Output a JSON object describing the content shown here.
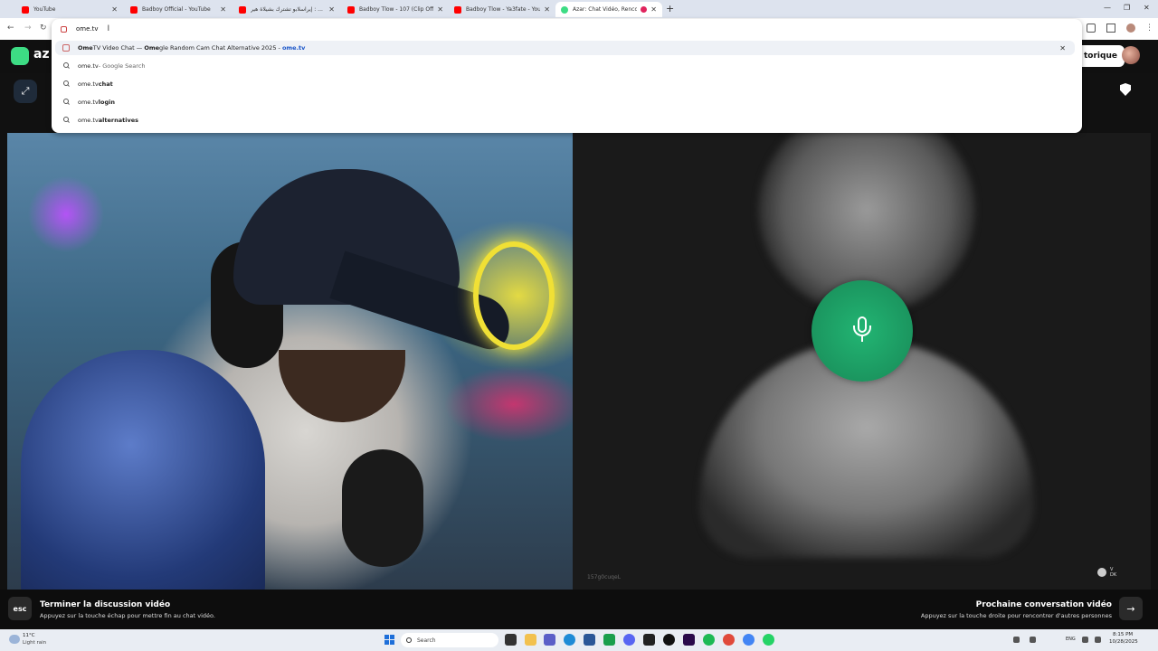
{
  "browser": {
    "tabs": [
      {
        "title": "YouTube",
        "favicon": "youtube-icon",
        "active": false
      },
      {
        "title": "Badboy Official - YouTube",
        "favicon": "youtube-icon",
        "active": false
      },
      {
        "title": "إيراسلابو تشترك بشيلاة هير : ...",
        "favicon": "youtube-icon",
        "active": false
      },
      {
        "title": "Badboy Tlow - 107 (Clip Officiel)",
        "favicon": "youtube-icon",
        "active": false
      },
      {
        "title": "Badboy Tlow - Ya3fate - YouTube",
        "favicon": "youtube-icon",
        "active": false
      },
      {
        "title": "Azar: Chat Vidéo, Rencontre",
        "favicon": "azar-icon",
        "active": true
      }
    ],
    "omnibox": {
      "input_value": "ome.tv",
      "suggestions": [
        {
          "prefix": "Ome",
          "rest": "TV Video Chat — ",
          "match2": "Ome",
          "rest2": "gle Random Cam Chat Alternative 2025 - ",
          "url": "ome.tv",
          "icon": "history-icon"
        },
        {
          "query": "ome.tv",
          "extra": "",
          "suffix": " - Google Search",
          "icon": "search-icon"
        },
        {
          "query": "ome.tv",
          "extra": " chat",
          "suffix": "",
          "icon": "search-icon"
        },
        {
          "query": "ome.tv",
          "extra": " login",
          "suffix": "",
          "icon": "search-icon"
        },
        {
          "query": "ome.tv",
          "extra": " alternatives",
          "suffix": "",
          "icon": "search-icon"
        }
      ]
    }
  },
  "page": {
    "logo_text": "az",
    "history_button": "torique",
    "accent_color": "#3ddc84",
    "peer_id": "157g0cuqeL",
    "peer_meta_line1": "V",
    "peer_meta_line2": "DK",
    "end_title": "Terminer la discussion vidéo",
    "end_subtitle": "Appuyez sur la touche échap pour mettre fin au chat vidéo.",
    "esc_label": "esc",
    "next_title": "Prochaine conversation vidéo",
    "next_subtitle": "Appuyez sur la touche droite pour rencontrer d'autres personnes",
    "mic_color": "#1fa96a"
  },
  "taskbar": {
    "weather_temp": "11°C",
    "weather_desc": "Light rain",
    "search_placeholder": "Search",
    "lang": "ENG",
    "time": "8:15 PM",
    "date": "10/28/2025"
  }
}
